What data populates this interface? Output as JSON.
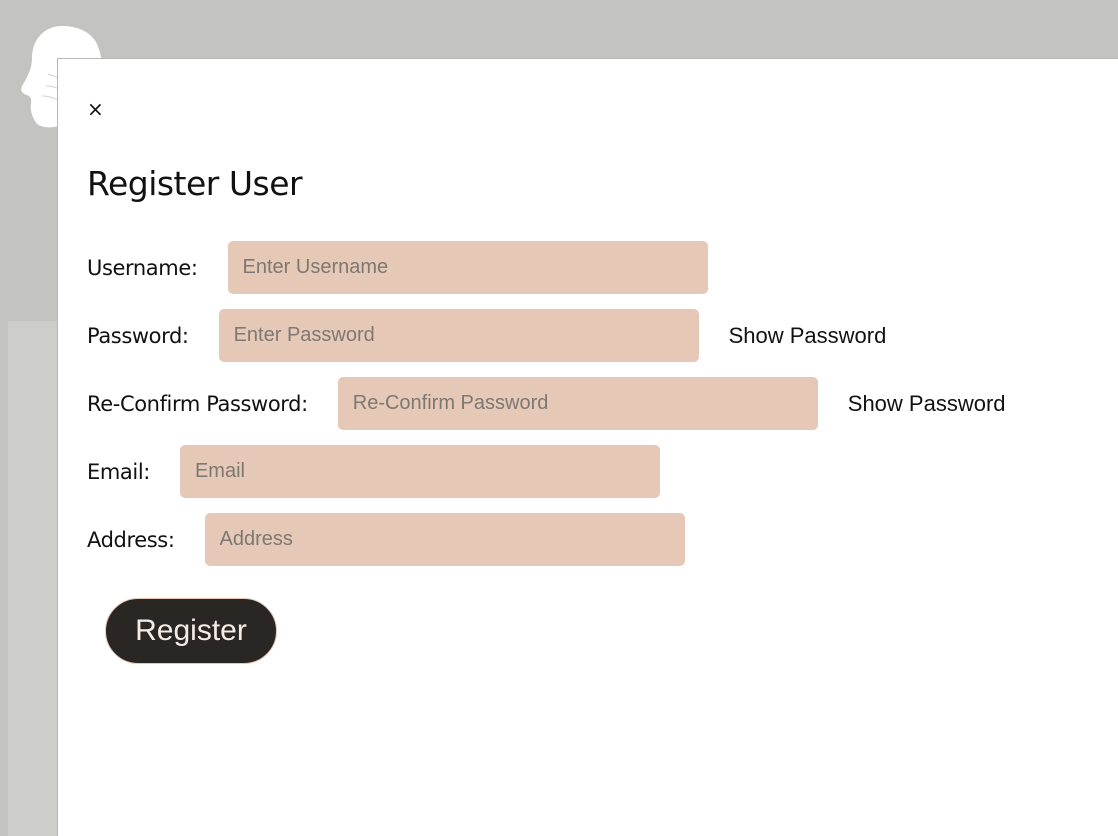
{
  "modal": {
    "close_label": "×",
    "title": "Register User",
    "fields": {
      "username": {
        "label": "Username:",
        "placeholder": "Enter Username",
        "value": ""
      },
      "password": {
        "label": "Password:",
        "placeholder": "Enter Password",
        "value": "",
        "toggle_label": "Show Password"
      },
      "confirm_password": {
        "label": "Re-Confirm Password:",
        "placeholder": "Re-Confirm Password",
        "value": "",
        "toggle_label": "Show Password"
      },
      "email": {
        "label": "Email:",
        "placeholder": "Email",
        "value": ""
      },
      "address": {
        "label": "Address:",
        "placeholder": "Address",
        "value": ""
      }
    },
    "register_label": "Register"
  },
  "icons": {
    "logo": "head-silhouette-icon",
    "close": "close-icon"
  },
  "colors": {
    "backdrop": "#c3c3c1",
    "input_background": "#e6c8b6",
    "button_background": "#2a2624",
    "button_text": "#f6ece6"
  }
}
